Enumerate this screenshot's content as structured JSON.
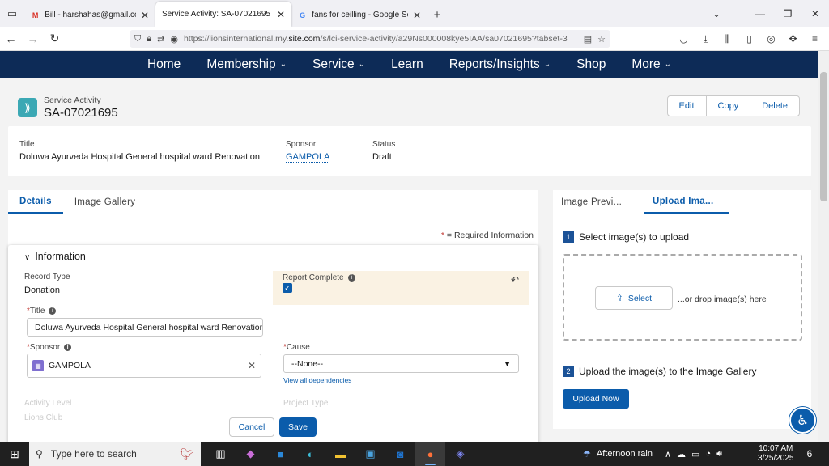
{
  "browser": {
    "tabs": [
      {
        "title": "Bill - harshahas@gmail.com - G",
        "fav": "M",
        "fav_color": "#d93025",
        "active": false
      },
      {
        "title": "Service Activity: SA-07021695",
        "fav": "",
        "fav_color": "",
        "active": true
      },
      {
        "title": "fans for ceilling - Google Search",
        "fav": "G",
        "fav_color": "#4285f4",
        "active": false
      }
    ],
    "url_prefix": "https://lionsinternational.my.",
    "url_domain": "site.com",
    "url_suffix": "/s/lci-service-activity/a29Ns000008kye5IAA/sa07021695?tabset-3"
  },
  "sitenav": {
    "items": [
      {
        "label": "Home",
        "caret": false
      },
      {
        "label": "Membership",
        "caret": true
      },
      {
        "label": "Service",
        "caret": true
      },
      {
        "label": "Learn",
        "caret": false
      },
      {
        "label": "Reports/Insights",
        "caret": true
      },
      {
        "label": "Shop",
        "caret": false
      },
      {
        "label": "More",
        "caret": true
      }
    ]
  },
  "record": {
    "type_label": "Service Activity",
    "id": "SA-07021695",
    "actions": [
      "Edit",
      "Copy",
      "Delete"
    ]
  },
  "highlights": {
    "title_label": "Title",
    "title_value": "Doluwa Ayurveda Hospital General hospital ward Renovation",
    "sponsor_label": "Sponsor",
    "sponsor_value": "GAMPOLA",
    "status_label": "Status",
    "status_value": "Draft"
  },
  "left_tabs": [
    "Details",
    "Image Gallery"
  ],
  "required_info": "= Required Information",
  "form": {
    "section": "Information",
    "record_type_label": "Record Type",
    "record_type_value": "Donation",
    "report_complete_label": "Report Complete",
    "title_label": "Title",
    "title_value": "Doluwa Ayurveda Hospital General hospital ward Renovation",
    "sponsor_label": "Sponsor",
    "sponsor_value": "GAMPOLA",
    "cause_label": "Cause",
    "cause_value": "--None--",
    "dependencies_link": "View all dependencies",
    "activity_level_label": "Activity Level",
    "activity_level_value": "Lions Club",
    "project_type_label": "Project Type",
    "cancel_label": "Cancel",
    "save_label": "Save"
  },
  "right_tabs": [
    "Image Previ...",
    "Upload Ima..."
  ],
  "upload": {
    "step1_num": "1",
    "step1": "Select image(s) to upload",
    "select_label": "Select",
    "drop_text": "...or drop image(s) here",
    "step2_num": "2",
    "step2": "Upload the image(s) to the Image Gallery",
    "upload_label": "Upload Now"
  },
  "taskbar": {
    "search_placeholder": "Type here to search",
    "weather": "Afternoon rain",
    "time": "10:07 AM",
    "date": "3/25/2025",
    "notif_count": "6"
  }
}
